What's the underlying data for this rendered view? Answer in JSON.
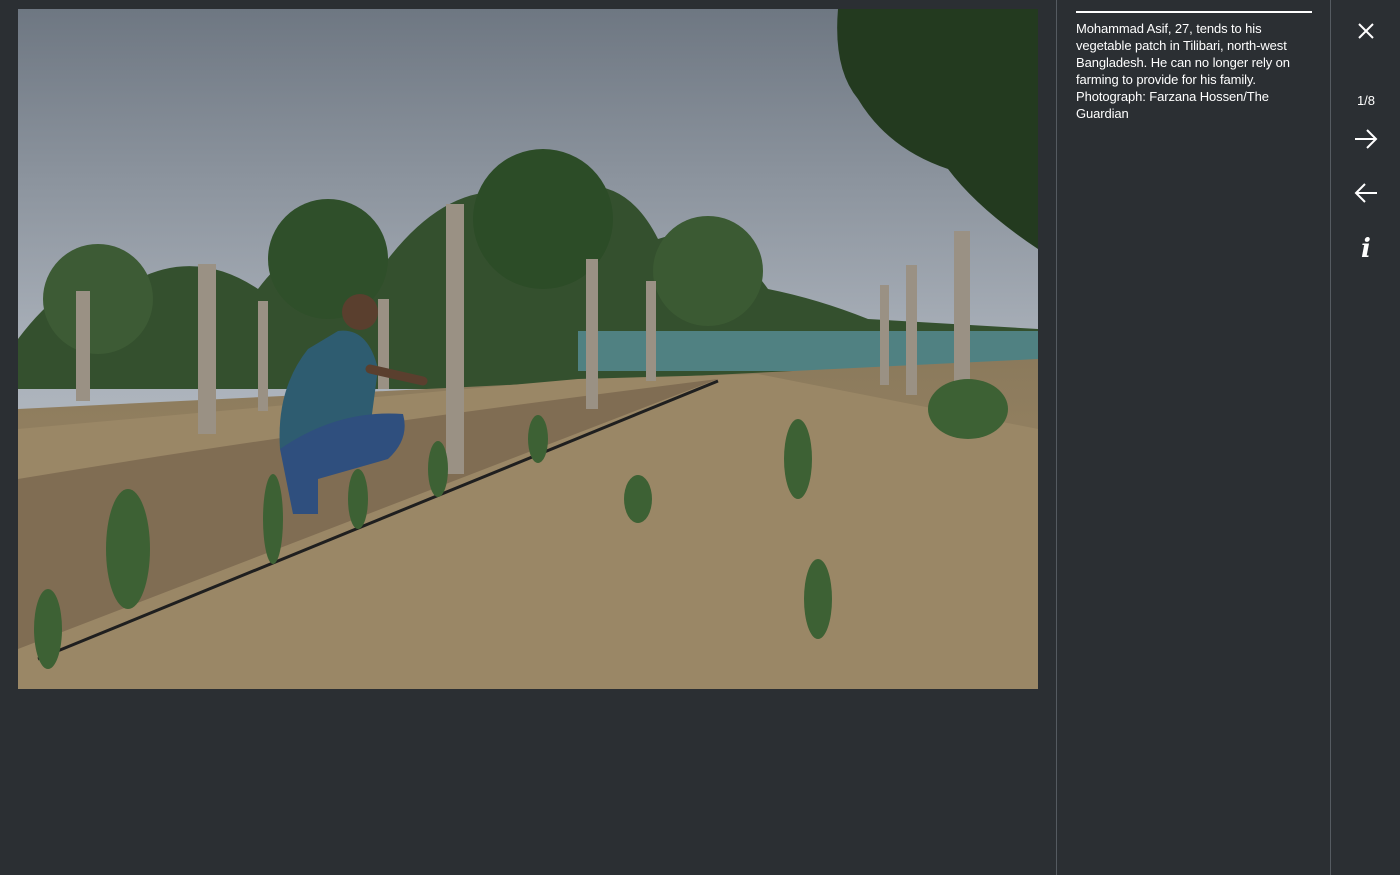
{
  "gallery": {
    "photo": {
      "alt": "Man kneeling to tend plants in a fenced vegetable patch"
    },
    "caption": "Mohammad Asif, 27, tends to his vegetable patch in Tilibari, north-west Bangladesh. He can no longer rely on farming to provide for his family. Photograph: Farzana Hossen/The Guardian",
    "counter": "1/8",
    "info_label": "i",
    "icons": {
      "close": "close-icon",
      "next": "arrow-right-icon",
      "prev": "arrow-left-icon",
      "info": "info-icon"
    },
    "colors": {
      "background": "#2b2f33",
      "text": "#ffffff",
      "divider": "#555b61"
    }
  }
}
